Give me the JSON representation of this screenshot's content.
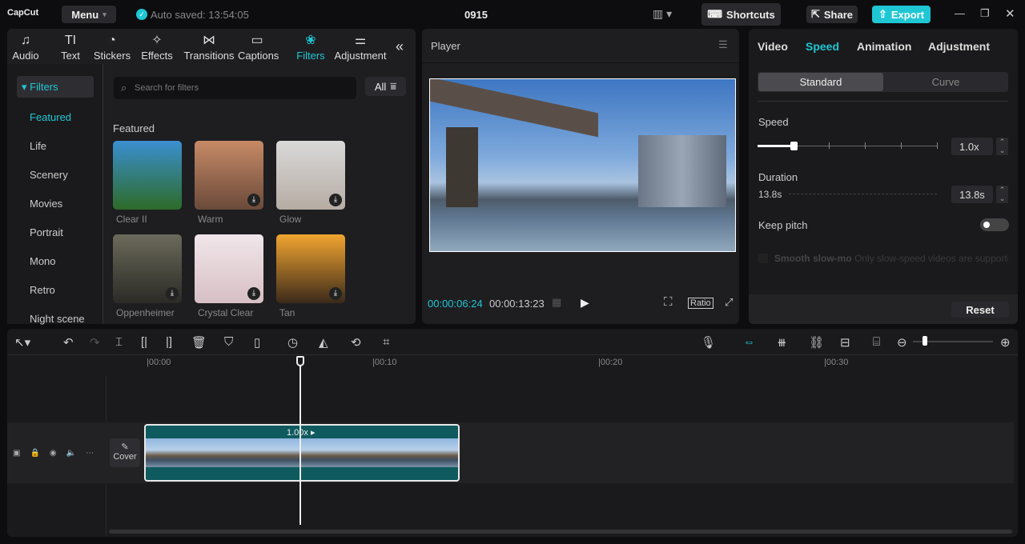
{
  "app": {
    "logo": "CapCut",
    "menu": "Menu",
    "autosave": "Auto saved: 13:54:05",
    "project": "0915",
    "shortcuts": "Shortcuts",
    "share": "Share",
    "export": "Export"
  },
  "toolbar_tabs": [
    {
      "label": "Audio",
      "icon": "♫"
    },
    {
      "label": "Text",
      "icon": "TI"
    },
    {
      "label": "Stickers",
      "icon": "◔"
    },
    {
      "label": "Effects",
      "icon": "✧"
    },
    {
      "label": "Transitions",
      "icon": "⋈"
    },
    {
      "label": "Captions",
      "icon": "▭"
    },
    {
      "label": "Filters",
      "icon": "❀"
    },
    {
      "label": "Adjustment",
      "icon": "⚌"
    }
  ],
  "filters": {
    "header": "▾ Filters",
    "categories": [
      "Featured",
      "Life",
      "Scenery",
      "Movies",
      "Portrait",
      "Mono",
      "Retro",
      "Night scene"
    ],
    "search_placeholder": "Search for filters",
    "all": "All",
    "section": "Featured",
    "items": [
      {
        "name": "Clear II",
        "colors": [
          "#3a8fd0",
          "#2d6b28"
        ]
      },
      {
        "name": "Warm",
        "colors": [
          "#c78a66",
          "#6a4a3a"
        ]
      },
      {
        "name": "Glow",
        "colors": [
          "#d9d9d9",
          "#b6aca3"
        ]
      },
      {
        "name": "Oppenheimer",
        "colors": [
          "#6b6a5a",
          "#2b2a26"
        ]
      },
      {
        "name": "Crystal Clear",
        "colors": [
          "#f0e6ea",
          "#d7bfc4"
        ]
      },
      {
        "name": "Tan",
        "colors": [
          "#f2a530",
          "#3b2a1a"
        ]
      }
    ]
  },
  "player": {
    "title": "Player",
    "current": "00:00:06:24",
    "total": "00:00:13:23",
    "ratio": "Ratio"
  },
  "right": {
    "tabs": [
      "Video",
      "Speed",
      "Animation",
      "Adjustment"
    ],
    "active": "Speed",
    "modes": [
      "Standard",
      "Curve"
    ],
    "speed_label": "Speed",
    "speed_value": "1.0x",
    "speed_fraction": 0.2,
    "duration_label": "Duration",
    "duration_start": "13.8s",
    "duration_value": "13.8s",
    "keep_pitch": "Keep pitch",
    "smooth": "Smooth slow-mo",
    "smooth_note": "Only slow-speed videos are supported",
    "reset": "Reset"
  },
  "timeline": {
    "ticks": [
      "00:00",
      "00:10",
      "00:20",
      "00:30"
    ],
    "cover": "Cover",
    "clip_speed": "1.00x ▸"
  },
  "colors": {
    "accent": "#1fc7d4"
  }
}
